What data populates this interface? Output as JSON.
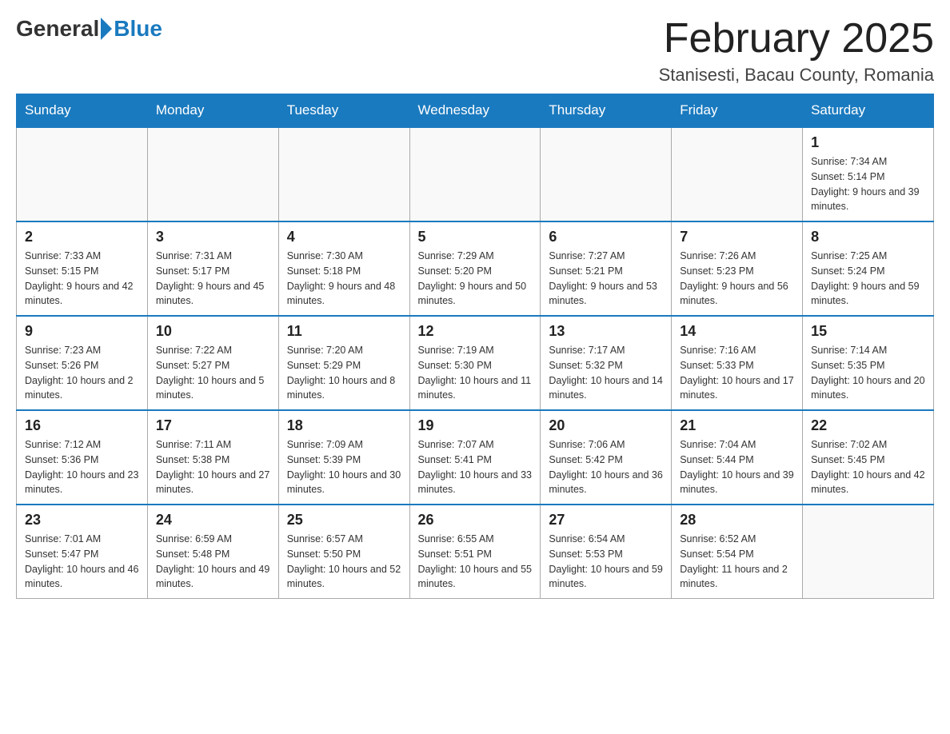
{
  "header": {
    "logo_general": "General",
    "logo_blue": "Blue",
    "month_title": "February 2025",
    "location": "Stanisesti, Bacau County, Romania"
  },
  "weekdays": [
    "Sunday",
    "Monday",
    "Tuesday",
    "Wednesday",
    "Thursday",
    "Friday",
    "Saturday"
  ],
  "weeks": [
    [
      {
        "day": "",
        "info": ""
      },
      {
        "day": "",
        "info": ""
      },
      {
        "day": "",
        "info": ""
      },
      {
        "day": "",
        "info": ""
      },
      {
        "day": "",
        "info": ""
      },
      {
        "day": "",
        "info": ""
      },
      {
        "day": "1",
        "info": "Sunrise: 7:34 AM\nSunset: 5:14 PM\nDaylight: 9 hours and 39 minutes."
      }
    ],
    [
      {
        "day": "2",
        "info": "Sunrise: 7:33 AM\nSunset: 5:15 PM\nDaylight: 9 hours and 42 minutes."
      },
      {
        "day": "3",
        "info": "Sunrise: 7:31 AM\nSunset: 5:17 PM\nDaylight: 9 hours and 45 minutes."
      },
      {
        "day": "4",
        "info": "Sunrise: 7:30 AM\nSunset: 5:18 PM\nDaylight: 9 hours and 48 minutes."
      },
      {
        "day": "5",
        "info": "Sunrise: 7:29 AM\nSunset: 5:20 PM\nDaylight: 9 hours and 50 minutes."
      },
      {
        "day": "6",
        "info": "Sunrise: 7:27 AM\nSunset: 5:21 PM\nDaylight: 9 hours and 53 minutes."
      },
      {
        "day": "7",
        "info": "Sunrise: 7:26 AM\nSunset: 5:23 PM\nDaylight: 9 hours and 56 minutes."
      },
      {
        "day": "8",
        "info": "Sunrise: 7:25 AM\nSunset: 5:24 PM\nDaylight: 9 hours and 59 minutes."
      }
    ],
    [
      {
        "day": "9",
        "info": "Sunrise: 7:23 AM\nSunset: 5:26 PM\nDaylight: 10 hours and 2 minutes."
      },
      {
        "day": "10",
        "info": "Sunrise: 7:22 AM\nSunset: 5:27 PM\nDaylight: 10 hours and 5 minutes."
      },
      {
        "day": "11",
        "info": "Sunrise: 7:20 AM\nSunset: 5:29 PM\nDaylight: 10 hours and 8 minutes."
      },
      {
        "day": "12",
        "info": "Sunrise: 7:19 AM\nSunset: 5:30 PM\nDaylight: 10 hours and 11 minutes."
      },
      {
        "day": "13",
        "info": "Sunrise: 7:17 AM\nSunset: 5:32 PM\nDaylight: 10 hours and 14 minutes."
      },
      {
        "day": "14",
        "info": "Sunrise: 7:16 AM\nSunset: 5:33 PM\nDaylight: 10 hours and 17 minutes."
      },
      {
        "day": "15",
        "info": "Sunrise: 7:14 AM\nSunset: 5:35 PM\nDaylight: 10 hours and 20 minutes."
      }
    ],
    [
      {
        "day": "16",
        "info": "Sunrise: 7:12 AM\nSunset: 5:36 PM\nDaylight: 10 hours and 23 minutes."
      },
      {
        "day": "17",
        "info": "Sunrise: 7:11 AM\nSunset: 5:38 PM\nDaylight: 10 hours and 27 minutes."
      },
      {
        "day": "18",
        "info": "Sunrise: 7:09 AM\nSunset: 5:39 PM\nDaylight: 10 hours and 30 minutes."
      },
      {
        "day": "19",
        "info": "Sunrise: 7:07 AM\nSunset: 5:41 PM\nDaylight: 10 hours and 33 minutes."
      },
      {
        "day": "20",
        "info": "Sunrise: 7:06 AM\nSunset: 5:42 PM\nDaylight: 10 hours and 36 minutes."
      },
      {
        "day": "21",
        "info": "Sunrise: 7:04 AM\nSunset: 5:44 PM\nDaylight: 10 hours and 39 minutes."
      },
      {
        "day": "22",
        "info": "Sunrise: 7:02 AM\nSunset: 5:45 PM\nDaylight: 10 hours and 42 minutes."
      }
    ],
    [
      {
        "day": "23",
        "info": "Sunrise: 7:01 AM\nSunset: 5:47 PM\nDaylight: 10 hours and 46 minutes."
      },
      {
        "day": "24",
        "info": "Sunrise: 6:59 AM\nSunset: 5:48 PM\nDaylight: 10 hours and 49 minutes."
      },
      {
        "day": "25",
        "info": "Sunrise: 6:57 AM\nSunset: 5:50 PM\nDaylight: 10 hours and 52 minutes."
      },
      {
        "day": "26",
        "info": "Sunrise: 6:55 AM\nSunset: 5:51 PM\nDaylight: 10 hours and 55 minutes."
      },
      {
        "day": "27",
        "info": "Sunrise: 6:54 AM\nSunset: 5:53 PM\nDaylight: 10 hours and 59 minutes."
      },
      {
        "day": "28",
        "info": "Sunrise: 6:52 AM\nSunset: 5:54 PM\nDaylight: 11 hours and 2 minutes."
      },
      {
        "day": "",
        "info": ""
      }
    ]
  ]
}
